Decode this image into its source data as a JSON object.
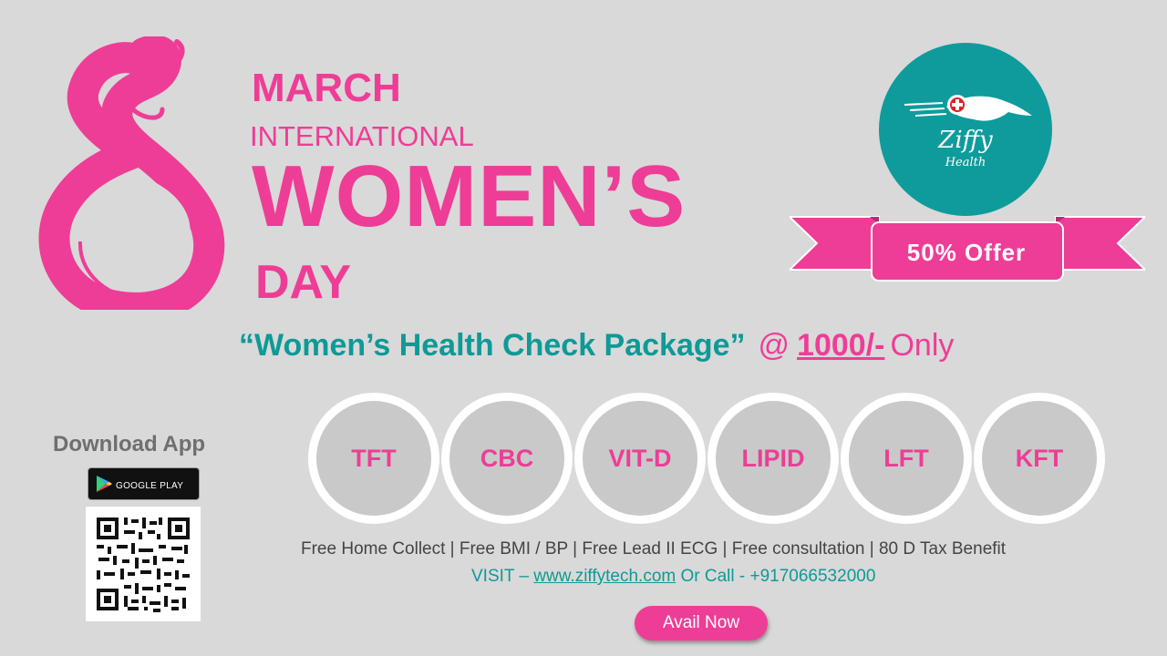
{
  "headline": {
    "month": "MARCH",
    "international": "INTERNATIONAL",
    "womens": "WOMEN’S",
    "day": "DAY"
  },
  "logo": {
    "name": "Ziffy",
    "sub": "Health",
    "bg_color": "#0f9b9b"
  },
  "offer": {
    "label": "50% Offer"
  },
  "package": {
    "name": "“Women’s Health Check Package”",
    "at": "@",
    "price": "1000/-",
    "only": "Only"
  },
  "tests": [
    "TFT",
    "CBC",
    "VIT-D",
    "LIPID",
    "LFT",
    "KFT"
  ],
  "download": {
    "title": "Download App",
    "store_label": "GOOGLE PLAY"
  },
  "benefits": "Free Home Collect | Free BMI / BP | Free Lead II ECG | Free consultation | 80 D Tax Benefit",
  "contact": {
    "visit_prefix": "VISIT – ",
    "url": "www.ziffytech.com",
    "call_text": " Or Call - +917066532000"
  },
  "cta": {
    "label": "Avail Now"
  },
  "colors": {
    "accent": "#ee3d96",
    "teal": "#0e9a96",
    "background": "#d9d9d9"
  }
}
